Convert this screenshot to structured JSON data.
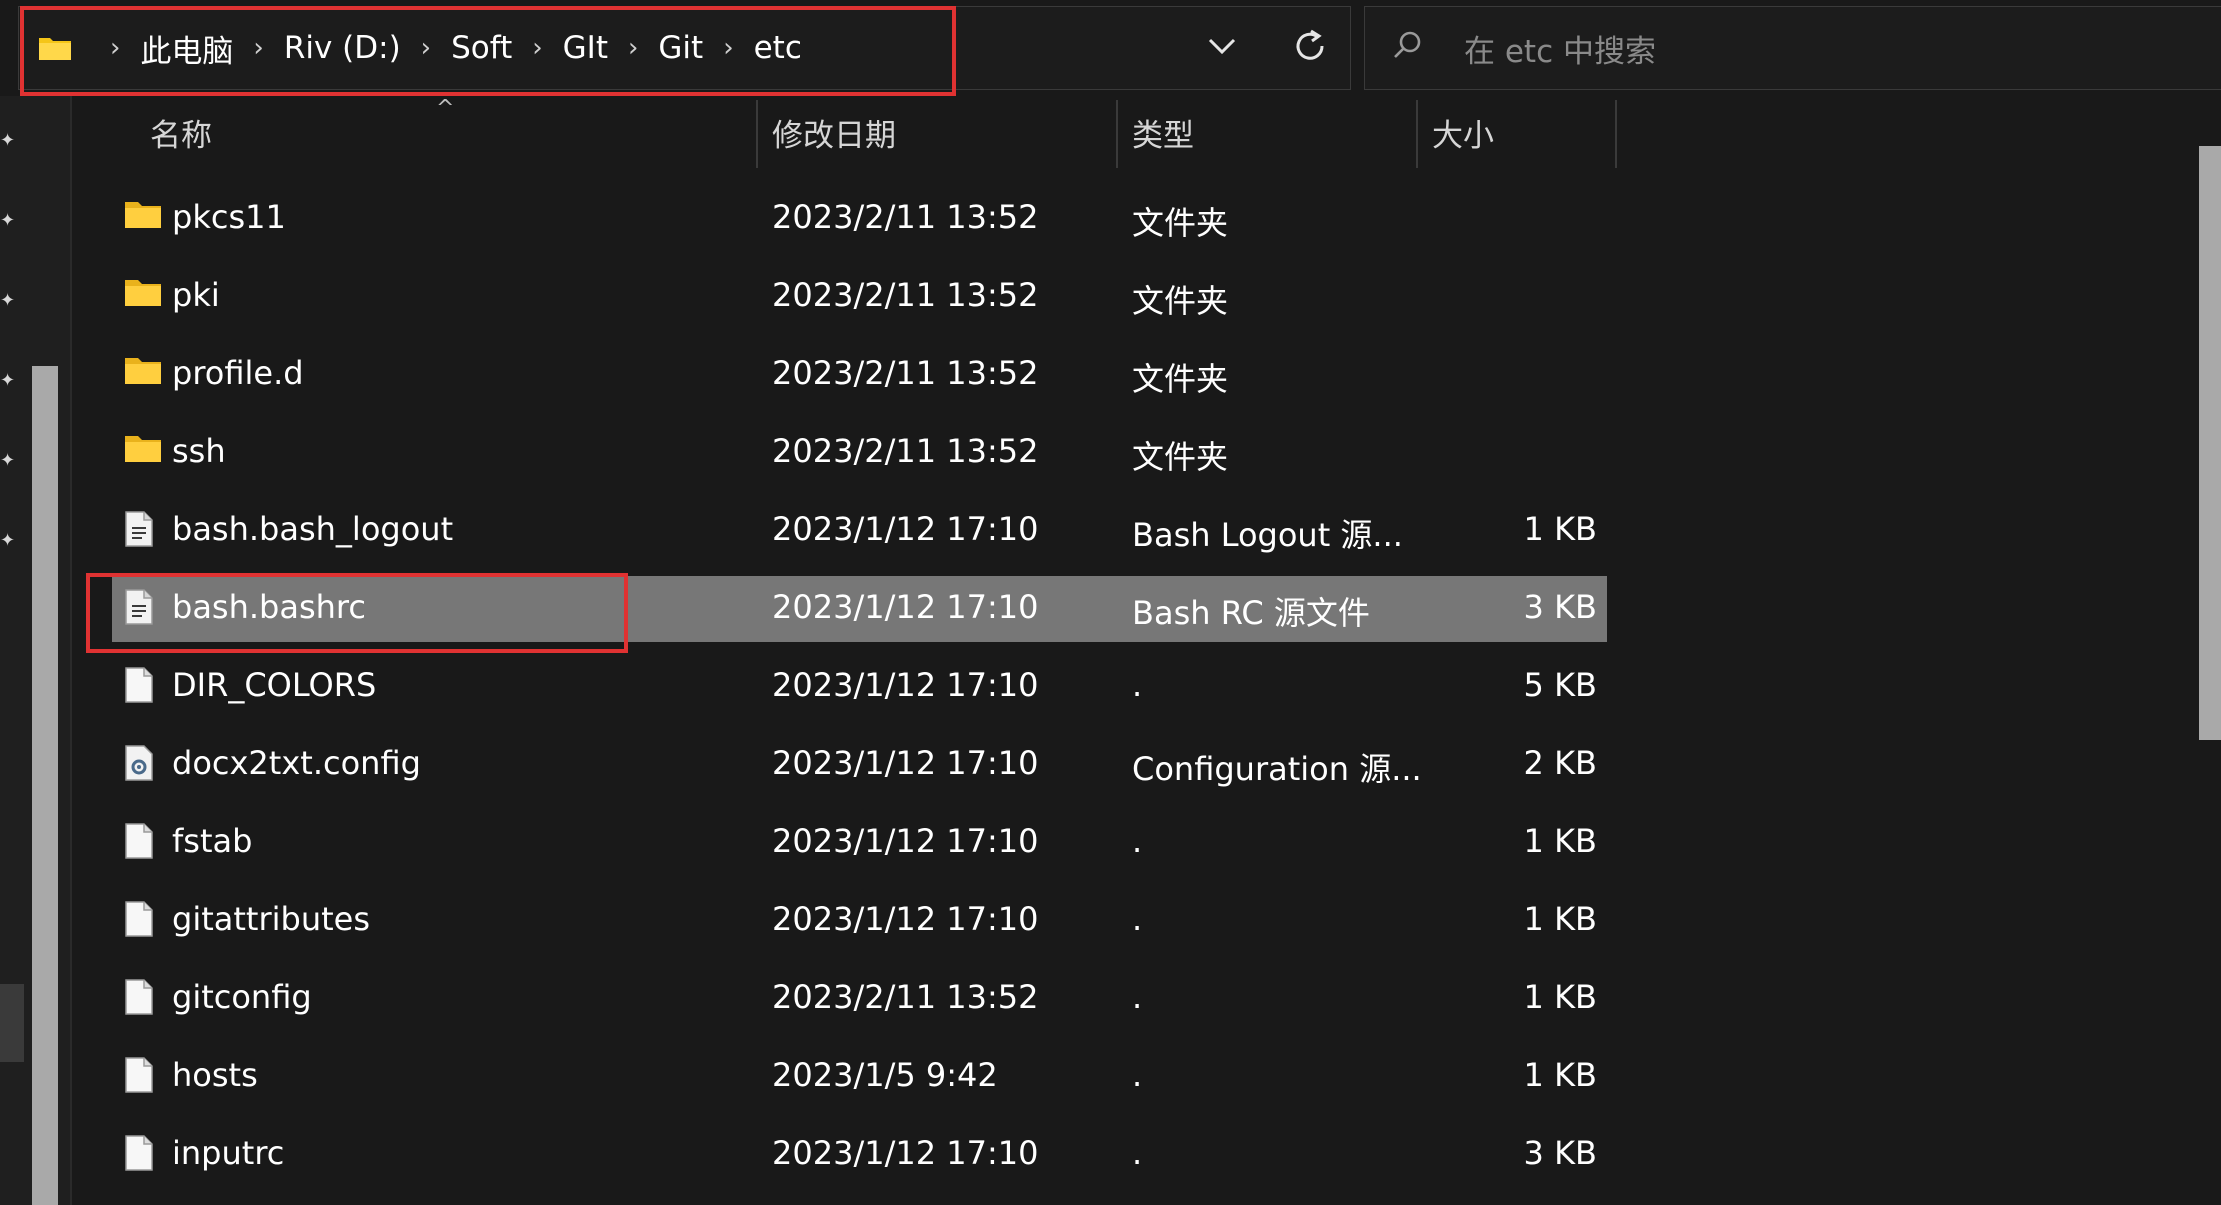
{
  "address_bar": {
    "crumbs": [
      "此电脑",
      "Riv (D:)",
      "Soft",
      "GIt",
      "Git",
      "etc"
    ],
    "separator": "›",
    "dropdown_icon": "chevron-down-icon",
    "refresh_icon": "refresh-icon"
  },
  "search": {
    "placeholder": "在 etc 中搜索",
    "icon": "search-icon"
  },
  "columns": {
    "name": "名称",
    "date": "修改日期",
    "type": "类型",
    "size": "大小",
    "sort_indicator": "^"
  },
  "rows": [
    {
      "icon": "folder-icon",
      "name": "pkcs11",
      "date": "2023/2/11 13:52",
      "type": "文件夹",
      "size": ""
    },
    {
      "icon": "folder-icon",
      "name": "pki",
      "date": "2023/2/11 13:52",
      "type": "文件夹",
      "size": ""
    },
    {
      "icon": "folder-icon",
      "name": "profile.d",
      "date": "2023/2/11 13:52",
      "type": "文件夹",
      "size": ""
    },
    {
      "icon": "folder-icon",
      "name": "ssh",
      "date": "2023/2/11 13:52",
      "type": "文件夹",
      "size": ""
    },
    {
      "icon": "text-file-icon",
      "name": "bash.bash_logout",
      "date": "2023/1/12 17:10",
      "type": "Bash Logout 源...",
      "size": "1 KB"
    },
    {
      "icon": "text-file-icon",
      "name": "bash.bashrc",
      "date": "2023/1/12 17:10",
      "type": "Bash RC 源文件",
      "size": "3 KB",
      "selected": true
    },
    {
      "icon": "blank-file-icon",
      "name": "DIR_COLORS",
      "date": "2023/1/12 17:10",
      "type": ".",
      "size": "5 KB"
    },
    {
      "icon": "config-file-icon",
      "name": "docx2txt.config",
      "date": "2023/1/12 17:10",
      "type": "Configuration 源...",
      "size": "2 KB"
    },
    {
      "icon": "blank-file-icon",
      "name": "fstab",
      "date": "2023/1/12 17:10",
      "type": ".",
      "size": "1 KB"
    },
    {
      "icon": "blank-file-icon",
      "name": "gitattributes",
      "date": "2023/1/12 17:10",
      "type": ".",
      "size": "1 KB"
    },
    {
      "icon": "blank-file-icon",
      "name": "gitconfig",
      "date": "2023/2/11 13:52",
      "type": ".",
      "size": "1 KB"
    },
    {
      "icon": "blank-file-icon",
      "name": "hosts",
      "date": "2023/1/5 9:42",
      "type": ".",
      "size": "1 KB"
    },
    {
      "icon": "blank-file-icon",
      "name": "inputrc",
      "date": "2023/1/12 17:10",
      "type": ".",
      "size": "3 KB"
    }
  ],
  "colors": {
    "background": "#191919",
    "selected_row": "#777777",
    "highlight_border": "#e03232",
    "folder_yellow": "#f5c518"
  }
}
